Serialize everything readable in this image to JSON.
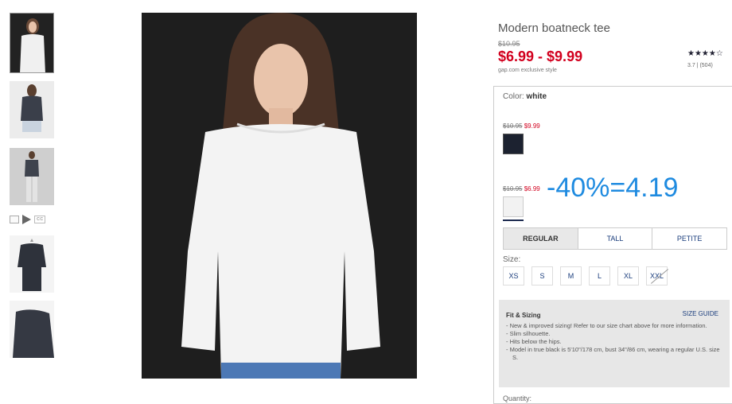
{
  "product": {
    "title": "Modern boatneck tee",
    "original_price": "$10.95",
    "price_range": "$6.99 - $9.99",
    "exclusive_note": "gap.com exclusive style",
    "stars": "★★★★☆",
    "rating_value": "3.7",
    "review_count": "(504)"
  },
  "color": {
    "label": "Color: ",
    "selected": "white",
    "swatches": [
      {
        "name": "black",
        "was": "$10.95",
        "now": "$9.99",
        "color": "#1c2230"
      },
      {
        "name": "white",
        "was": "$10.95",
        "now": "$6.99",
        "color": "#f2f2f2"
      }
    ]
  },
  "annotation": "-40%=4.19",
  "fit_tabs": [
    "REGULAR",
    "TALL",
    "PETITE"
  ],
  "size": {
    "label": "Size:",
    "options": [
      "XS",
      "S",
      "M",
      "L",
      "XL",
      "XXL"
    ]
  },
  "fit_sizing": {
    "title": "Fit & Sizing",
    "guide_link": "SIZE GUIDE",
    "notes": [
      "New & improved sizing! Refer to our size chart above for more information.",
      "Slim silhouette.",
      "Hits below the hips.",
      "Model in true black is 5'10\"/178 cm, bust 34\"/86 cm, wearing a regular U.S. size S."
    ]
  },
  "quantity_label": "Quantity:",
  "thumbnails": {
    "video_caption": "cc"
  },
  "colors": {
    "sale_red": "#d2001e",
    "link_blue": "#1a3d7c",
    "annotation_blue": "#1f8be0"
  }
}
